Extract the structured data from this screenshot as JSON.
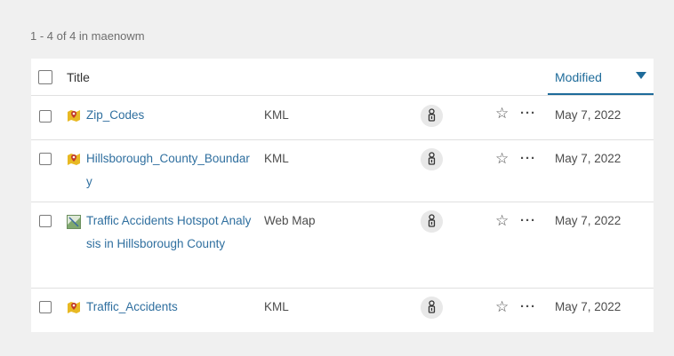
{
  "results_summary": "1 - 4 of 4 in maenowm",
  "table": {
    "columns": {
      "title": "Title",
      "modified": "Modified"
    },
    "rows": [
      {
        "title": "Zip_Codes",
        "type": "KML",
        "modified": "May 7, 2022",
        "icon": "kml-layer-icon"
      },
      {
        "title": "Hillsborough_County_Boundary",
        "type": "KML",
        "modified": "May 7, 2022",
        "icon": "kml-layer-icon"
      },
      {
        "title": "Traffic Accidents Hotspot Analysis in Hillsborough County",
        "type": "Web Map",
        "modified": "May 7, 2022",
        "icon": "web-map-icon"
      },
      {
        "title": "Traffic_Accidents",
        "type": "KML",
        "modified": "May 7, 2022",
        "icon": "kml-layer-icon"
      }
    ]
  },
  "colors": {
    "link": "#2f6f9f",
    "accent": "#1e6b9a",
    "kml_icon": "#e8b923",
    "background": "#f0f0f0"
  }
}
